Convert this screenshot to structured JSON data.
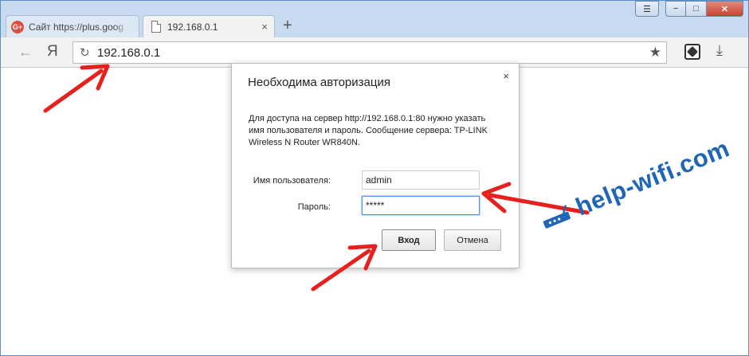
{
  "browser": {
    "tabs": [
      {
        "title": "Сайт https://plus.goog",
        "favicon": "g-plus-icon",
        "active": false
      },
      {
        "title": "192.168.0.1",
        "favicon": "document-icon",
        "active": true
      }
    ],
    "tab_close_glyph": "×",
    "new_tab_glyph": "+",
    "window_controls": {
      "menu": "☰",
      "minimize": "−",
      "maximize": "□",
      "close": "✕"
    },
    "toolbar": {
      "back_glyph": "←",
      "yandex_glyph": "Я",
      "reload_glyph": "↻",
      "url": "192.168.0.1",
      "star_glyph": "★",
      "download_glyph": "⤓"
    }
  },
  "auth_dialog": {
    "title": "Необходима авторизация",
    "close_glyph": "×",
    "message": "Для доступа на сервер http://192.168.0.1:80 нужно указать имя пользователя и пароль. Сообщение сервера: TP-LINK Wireless N Router WR840N.",
    "username_label": "Имя пользователя:",
    "username_value": "admin",
    "password_label": "Пароль:",
    "password_value": "*****",
    "login_button": "Вход",
    "cancel_button": "Отмена"
  },
  "watermark": {
    "text": "help-wifi.com"
  },
  "colors": {
    "annotation_arrow": "#e8201d",
    "watermark": "#1f66b6",
    "focus_border": "#4d90fe"
  }
}
